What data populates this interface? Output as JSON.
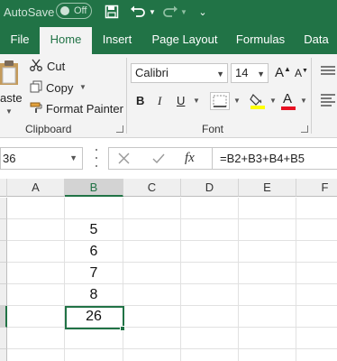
{
  "titlebar": {
    "autosave_label": "AutoSave",
    "autosave_state": "Off",
    "accent_color": "#217346"
  },
  "tabs": [
    {
      "label": "File",
      "active": false
    },
    {
      "label": "Home",
      "active": true
    },
    {
      "label": "Insert",
      "active": false
    },
    {
      "label": "Page Layout",
      "active": false
    },
    {
      "label": "Formulas",
      "active": false
    },
    {
      "label": "Data",
      "active": false
    }
  ],
  "clipboard": {
    "paste_label": "aste",
    "cut_label": "Cut",
    "copy_label": "Copy",
    "format_painter_label": "Format Painter",
    "group_label": "Clipboard"
  },
  "font": {
    "family": "Calibri",
    "size": "14",
    "bold": "B",
    "italic": "I",
    "underline": "U",
    "color_swatch_font": "A",
    "group_label": "Font",
    "highlight_color": "#ffff00",
    "font_color": "#e81123"
  },
  "formula_bar": {
    "name_box": "36",
    "cancel_icon": "x-icon",
    "enter_icon": "check-icon",
    "fx_label": "fx",
    "formula": "=B2+B3+B4+B5"
  },
  "grid": {
    "columns": [
      "A",
      "B",
      "C",
      "D",
      "E",
      "F"
    ],
    "selected_column": "B",
    "cells_b": [
      "",
      "5",
      "6",
      "7",
      "8",
      "26"
    ],
    "active_cell_value": "26"
  }
}
